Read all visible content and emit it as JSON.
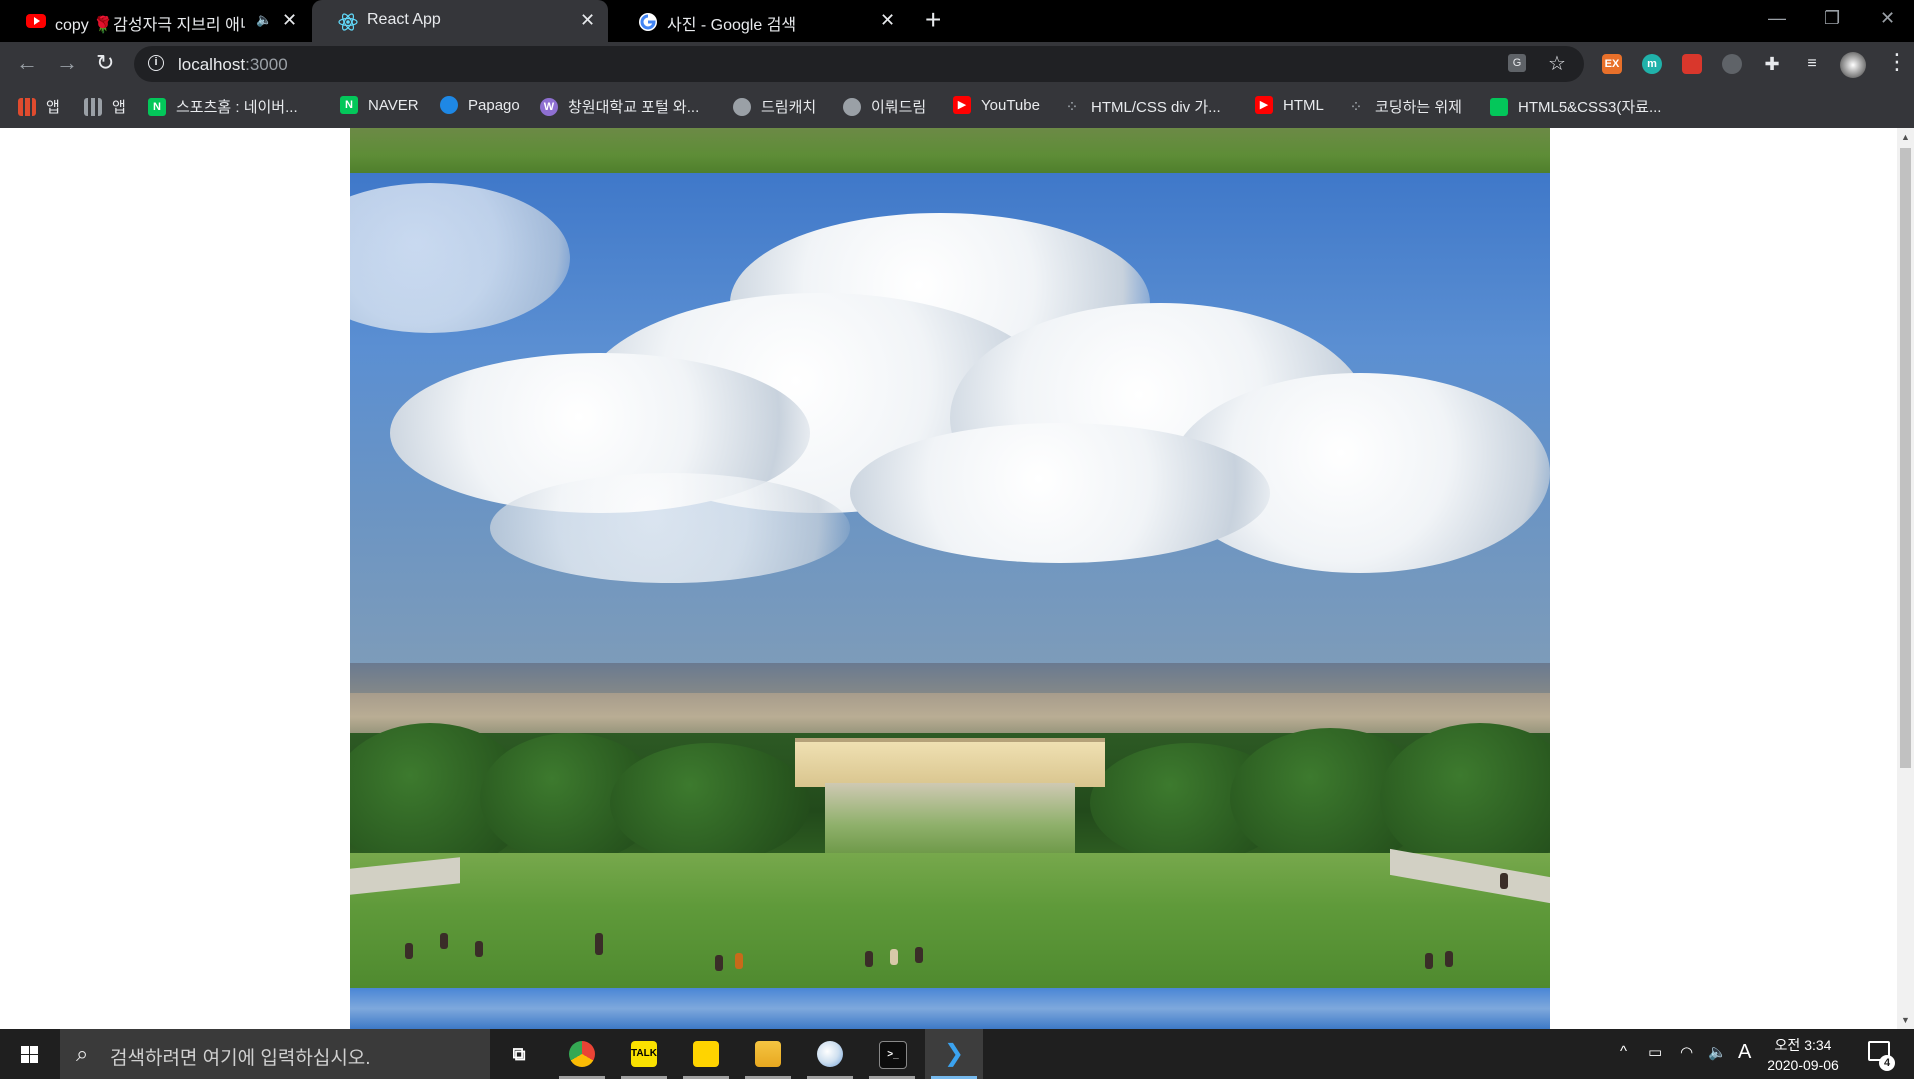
{
  "tabs": [
    {
      "title": "copy 🌹감성자극 지브리 애니",
      "favicon": "youtube-icon",
      "audio": "speaker-icon"
    },
    {
      "title": "React App",
      "favicon": "react-icon",
      "active": true
    },
    {
      "title": "사진 - Google 검색",
      "favicon": "google-icon"
    }
  ],
  "toolbar": {
    "url_host": "localhost",
    "url_port": ":3000"
  },
  "bookmarks": [
    {
      "label": "앱",
      "icon": "apps-grid-color-icon",
      "color": "#e04b2e"
    },
    {
      "label": "앱",
      "icon": "apps-grid-icon",
      "color": "#9aa0a6"
    },
    {
      "label": "스포츠홈 : 네이버...",
      "icon": "naver-icon",
      "color": "#03c75a"
    },
    {
      "label": "NAVER",
      "icon": "naver-icon",
      "color": "#03c75a"
    },
    {
      "label": "Papago",
      "icon": "papago-icon",
      "color": "#1e88e5"
    },
    {
      "label": "창원대학교 포털 와...",
      "icon": "university-icon",
      "color": "#8e6fd1"
    },
    {
      "label": "드림캐치",
      "icon": "globe-icon",
      "color": "#9aa0a6"
    },
    {
      "label": "이뤄드림",
      "icon": "globe-icon",
      "color": "#9aa0a6"
    },
    {
      "label": "YouTube",
      "icon": "youtube-icon",
      "color": "#ff0000"
    },
    {
      "label": "HTML/CSS div 가...",
      "icon": "dots-icon",
      "color": "#9aa0a6"
    },
    {
      "label": "HTML",
      "icon": "youtube-icon",
      "color": "#ff0000"
    },
    {
      "label": "코딩하는 위제",
      "icon": "dots-icon",
      "color": "#9aa0a6"
    },
    {
      "label": "HTML5&CSS3(자료...",
      "icon": "kakao-icon",
      "color": "#03c75a"
    }
  ],
  "taskbar": {
    "search_placeholder": "검색하려면 여기에 입력하십시오.",
    "apps": [
      {
        "name": "task-view-icon"
      },
      {
        "name": "chrome-icon",
        "running": true
      },
      {
        "name": "kakaotalk-icon",
        "label": "TALK",
        "running": true
      },
      {
        "name": "sticky-notes-icon",
        "running": true
      },
      {
        "name": "file-explorer-icon",
        "running": true
      },
      {
        "name": "paint-icon",
        "running": true
      },
      {
        "name": "terminal-icon",
        "running": true
      },
      {
        "name": "vscode-icon",
        "running": true,
        "active": true
      }
    ],
    "ime": "A",
    "time": "오전 3:34",
    "date": "2020-09-06",
    "notifications": "4"
  },
  "extensions": [
    {
      "name": "ex-extension-icon",
      "label": "EX",
      "color": "#e8702a"
    },
    {
      "name": "m-extension-icon",
      "label": "m",
      "color": "#20b2aa"
    },
    {
      "name": "red-extension-icon",
      "label": "",
      "color": "#d9372c"
    },
    {
      "name": "mouse-extension-icon",
      "label": "",
      "color": "#5f6368"
    },
    {
      "name": "puzzle-icon",
      "label": "",
      "color": "#35363a"
    }
  ]
}
